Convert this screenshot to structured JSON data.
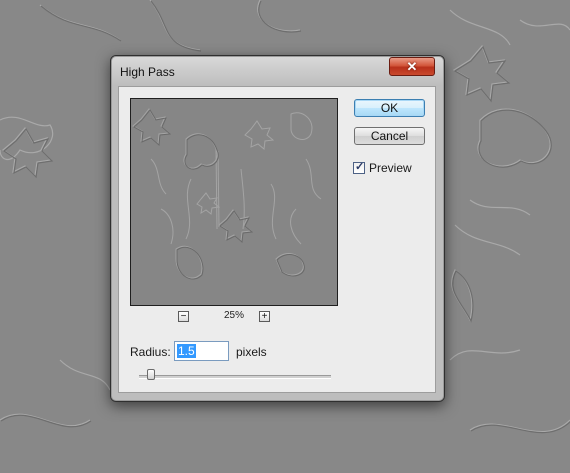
{
  "dialog": {
    "title": "High Pass",
    "close_symbol": "✕"
  },
  "preview": {
    "zoom_out_symbol": "−",
    "zoom_in_symbol": "+",
    "zoom_level": "25%"
  },
  "buttons": {
    "ok_label": "OK",
    "cancel_label": "Cancel"
  },
  "options": {
    "preview_label": "Preview",
    "preview_checked": true,
    "check_symbol": "✓"
  },
  "radius": {
    "label": "Radius:",
    "value": "1.5",
    "units": "pixels",
    "slider_fraction": 0.06
  },
  "icons": {
    "close": "close-icon",
    "zoom_out": "minus-icon",
    "zoom_in": "plus-icon",
    "check": "checkmark-icon"
  },
  "colors": {
    "canvas_grey": "#888888",
    "close_button_red": "#c94a2e",
    "selection_blue": "#3399ff",
    "default_button_border": "#3c7fb1"
  }
}
